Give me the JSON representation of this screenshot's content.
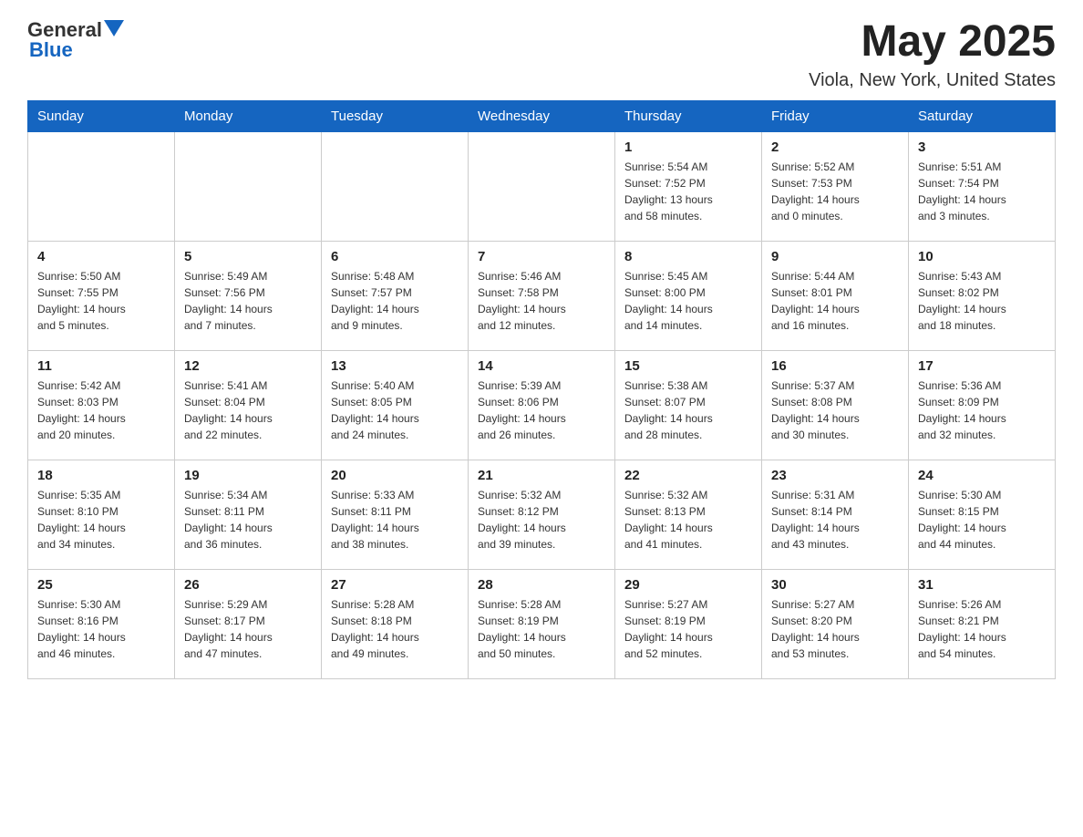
{
  "header": {
    "logo_general": "General",
    "logo_blue": "Blue",
    "month_title": "May 2025",
    "location": "Viola, New York, United States"
  },
  "days_of_week": [
    "Sunday",
    "Monday",
    "Tuesday",
    "Wednesday",
    "Thursday",
    "Friday",
    "Saturday"
  ],
  "weeks": [
    {
      "days": [
        {
          "num": "",
          "info": ""
        },
        {
          "num": "",
          "info": ""
        },
        {
          "num": "",
          "info": ""
        },
        {
          "num": "",
          "info": ""
        },
        {
          "num": "1",
          "info": "Sunrise: 5:54 AM\nSunset: 7:52 PM\nDaylight: 13 hours\nand 58 minutes."
        },
        {
          "num": "2",
          "info": "Sunrise: 5:52 AM\nSunset: 7:53 PM\nDaylight: 14 hours\nand 0 minutes."
        },
        {
          "num": "3",
          "info": "Sunrise: 5:51 AM\nSunset: 7:54 PM\nDaylight: 14 hours\nand 3 minutes."
        }
      ]
    },
    {
      "days": [
        {
          "num": "4",
          "info": "Sunrise: 5:50 AM\nSunset: 7:55 PM\nDaylight: 14 hours\nand 5 minutes."
        },
        {
          "num": "5",
          "info": "Sunrise: 5:49 AM\nSunset: 7:56 PM\nDaylight: 14 hours\nand 7 minutes."
        },
        {
          "num": "6",
          "info": "Sunrise: 5:48 AM\nSunset: 7:57 PM\nDaylight: 14 hours\nand 9 minutes."
        },
        {
          "num": "7",
          "info": "Sunrise: 5:46 AM\nSunset: 7:58 PM\nDaylight: 14 hours\nand 12 minutes."
        },
        {
          "num": "8",
          "info": "Sunrise: 5:45 AM\nSunset: 8:00 PM\nDaylight: 14 hours\nand 14 minutes."
        },
        {
          "num": "9",
          "info": "Sunrise: 5:44 AM\nSunset: 8:01 PM\nDaylight: 14 hours\nand 16 minutes."
        },
        {
          "num": "10",
          "info": "Sunrise: 5:43 AM\nSunset: 8:02 PM\nDaylight: 14 hours\nand 18 minutes."
        }
      ]
    },
    {
      "days": [
        {
          "num": "11",
          "info": "Sunrise: 5:42 AM\nSunset: 8:03 PM\nDaylight: 14 hours\nand 20 minutes."
        },
        {
          "num": "12",
          "info": "Sunrise: 5:41 AM\nSunset: 8:04 PM\nDaylight: 14 hours\nand 22 minutes."
        },
        {
          "num": "13",
          "info": "Sunrise: 5:40 AM\nSunset: 8:05 PM\nDaylight: 14 hours\nand 24 minutes."
        },
        {
          "num": "14",
          "info": "Sunrise: 5:39 AM\nSunset: 8:06 PM\nDaylight: 14 hours\nand 26 minutes."
        },
        {
          "num": "15",
          "info": "Sunrise: 5:38 AM\nSunset: 8:07 PM\nDaylight: 14 hours\nand 28 minutes."
        },
        {
          "num": "16",
          "info": "Sunrise: 5:37 AM\nSunset: 8:08 PM\nDaylight: 14 hours\nand 30 minutes."
        },
        {
          "num": "17",
          "info": "Sunrise: 5:36 AM\nSunset: 8:09 PM\nDaylight: 14 hours\nand 32 minutes."
        }
      ]
    },
    {
      "days": [
        {
          "num": "18",
          "info": "Sunrise: 5:35 AM\nSunset: 8:10 PM\nDaylight: 14 hours\nand 34 minutes."
        },
        {
          "num": "19",
          "info": "Sunrise: 5:34 AM\nSunset: 8:11 PM\nDaylight: 14 hours\nand 36 minutes."
        },
        {
          "num": "20",
          "info": "Sunrise: 5:33 AM\nSunset: 8:11 PM\nDaylight: 14 hours\nand 38 minutes."
        },
        {
          "num": "21",
          "info": "Sunrise: 5:32 AM\nSunset: 8:12 PM\nDaylight: 14 hours\nand 39 minutes."
        },
        {
          "num": "22",
          "info": "Sunrise: 5:32 AM\nSunset: 8:13 PM\nDaylight: 14 hours\nand 41 minutes."
        },
        {
          "num": "23",
          "info": "Sunrise: 5:31 AM\nSunset: 8:14 PM\nDaylight: 14 hours\nand 43 minutes."
        },
        {
          "num": "24",
          "info": "Sunrise: 5:30 AM\nSunset: 8:15 PM\nDaylight: 14 hours\nand 44 minutes."
        }
      ]
    },
    {
      "days": [
        {
          "num": "25",
          "info": "Sunrise: 5:30 AM\nSunset: 8:16 PM\nDaylight: 14 hours\nand 46 minutes."
        },
        {
          "num": "26",
          "info": "Sunrise: 5:29 AM\nSunset: 8:17 PM\nDaylight: 14 hours\nand 47 minutes."
        },
        {
          "num": "27",
          "info": "Sunrise: 5:28 AM\nSunset: 8:18 PM\nDaylight: 14 hours\nand 49 minutes."
        },
        {
          "num": "28",
          "info": "Sunrise: 5:28 AM\nSunset: 8:19 PM\nDaylight: 14 hours\nand 50 minutes."
        },
        {
          "num": "29",
          "info": "Sunrise: 5:27 AM\nSunset: 8:19 PM\nDaylight: 14 hours\nand 52 minutes."
        },
        {
          "num": "30",
          "info": "Sunrise: 5:27 AM\nSunset: 8:20 PM\nDaylight: 14 hours\nand 53 minutes."
        },
        {
          "num": "31",
          "info": "Sunrise: 5:26 AM\nSunset: 8:21 PM\nDaylight: 14 hours\nand 54 minutes."
        }
      ]
    }
  ]
}
